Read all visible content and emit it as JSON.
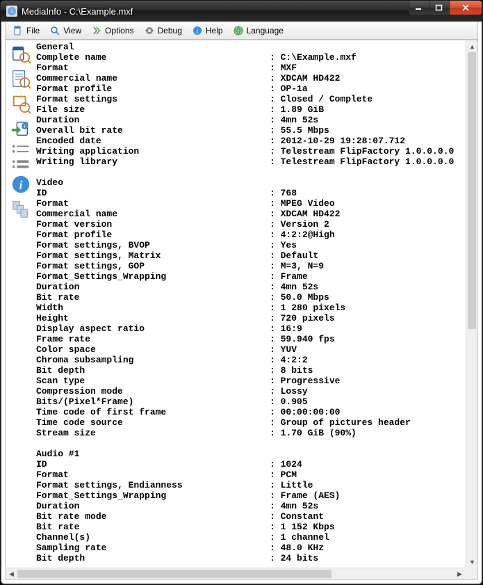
{
  "window": {
    "title": "MediaInfo - C:\\Example.mxf"
  },
  "menu": {
    "file": "File",
    "view": "View",
    "options": "Options",
    "debug": "Debug",
    "help": "Help",
    "language": "Language"
  },
  "sections": [
    {
      "title": "General",
      "rows": [
        {
          "k": "Complete name",
          "v": "C:\\Example.mxf"
        },
        {
          "k": "Format",
          "v": "MXF"
        },
        {
          "k": "Commercial name",
          "v": "XDCAM HD422"
        },
        {
          "k": "Format profile",
          "v": "OP-1a"
        },
        {
          "k": "Format settings",
          "v": "Closed / Complete"
        },
        {
          "k": "File size",
          "v": "1.89 GiB"
        },
        {
          "k": "Duration",
          "v": "4mn 52s"
        },
        {
          "k": "Overall bit rate",
          "v": "55.5 Mbps"
        },
        {
          "k": "Encoded date",
          "v": "2012-10-29 19:28:07.712"
        },
        {
          "k": "Writing application",
          "v": "Telestream FlipFactory 1.0.0.0.0"
        },
        {
          "k": "Writing library",
          "v": "Telestream FlipFactory 1.0.0.0.0"
        }
      ]
    },
    {
      "title": "Video",
      "rows": [
        {
          "k": "ID",
          "v": "768"
        },
        {
          "k": "Format",
          "v": "MPEG Video"
        },
        {
          "k": "Commercial name",
          "v": "XDCAM HD422"
        },
        {
          "k": "Format version",
          "v": "Version 2"
        },
        {
          "k": "Format profile",
          "v": "4:2:2@High"
        },
        {
          "k": "Format settings, BVOP",
          "v": "Yes"
        },
        {
          "k": "Format settings, Matrix",
          "v": "Default"
        },
        {
          "k": "Format settings, GOP",
          "v": "M=3, N=9"
        },
        {
          "k": "Format_Settings_Wrapping",
          "v": "Frame"
        },
        {
          "k": "Duration",
          "v": "4mn 52s"
        },
        {
          "k": "Bit rate",
          "v": "50.0 Mbps"
        },
        {
          "k": "Width",
          "v": "1 280 pixels"
        },
        {
          "k": "Height",
          "v": "720 pixels"
        },
        {
          "k": "Display aspect ratio",
          "v": "16:9"
        },
        {
          "k": "Frame rate",
          "v": "59.940 fps"
        },
        {
          "k": "Color space",
          "v": "YUV"
        },
        {
          "k": "Chroma subsampling",
          "v": "4:2:2"
        },
        {
          "k": "Bit depth",
          "v": "8 bits"
        },
        {
          "k": "Scan type",
          "v": "Progressive"
        },
        {
          "k": "Compression mode",
          "v": "Lossy"
        },
        {
          "k": "Bits/(Pixel*Frame)",
          "v": "0.905"
        },
        {
          "k": "Time code of first frame",
          "v": "00:00:00:00"
        },
        {
          "k": "Time code source",
          "v": "Group of pictures header"
        },
        {
          "k": "Stream size",
          "v": "1.70 GiB (90%)"
        }
      ]
    },
    {
      "title": "Audio #1",
      "rows": [
        {
          "k": "ID",
          "v": "1024"
        },
        {
          "k": "Format",
          "v": "PCM"
        },
        {
          "k": "Format settings, Endianness",
          "v": "Little"
        },
        {
          "k": "Format_Settings_Wrapping",
          "v": "Frame (AES)"
        },
        {
          "k": "Duration",
          "v": "4mn 52s"
        },
        {
          "k": "Bit rate mode",
          "v": "Constant"
        },
        {
          "k": "Bit rate",
          "v": "1 152 Kbps"
        },
        {
          "k": "Channel(s)",
          "v": "1 channel"
        },
        {
          "k": "Sampling rate",
          "v": "48.0 KHz"
        },
        {
          "k": "Bit depth",
          "v": "24 bits"
        }
      ]
    }
  ]
}
